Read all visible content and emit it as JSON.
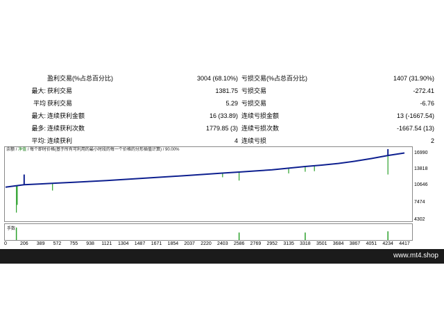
{
  "stats": [
    {
      "prefix": "",
      "label": "盈利交易(%占总百分比)",
      "value": "3004 (68.10%)",
      "label2": "亏损交易(%占总百分比)",
      "value2": "1407 (31.90%)"
    },
    {
      "prefix": "最大:",
      "label": "获利交易",
      "value": "1381.75",
      "label2": "亏损交易",
      "value2": "-272.41"
    },
    {
      "prefix": "平均",
      "label": "获利交易",
      "value": "5.29",
      "label2": "亏损交易",
      "value2": "-6.76"
    },
    {
      "prefix": "最大:",
      "label": "连续获利金额",
      "value": "16 (33.89)",
      "label2": "连续亏损金额",
      "value2": "13 (-1667.54)"
    },
    {
      "prefix": "最多:",
      "label": "连续获利次数",
      "value": "1779.85 (3)",
      "label2": "连续亏损次数",
      "value2": "-1667.54 (13)"
    },
    {
      "prefix": "平均:",
      "label": "连续获利",
      "value": "4",
      "label2": "连续亏损",
      "value2": "2"
    }
  ],
  "chart": {
    "title_balance": "余额",
    "title_equity": "净值",
    "title_rest": "/ 每个即时价格(基于所有可利用的最小时段的每一个价格的分形插值计算) / 90.00%",
    "volume_label": "手数",
    "colors": {
      "balance": "#0d1f8f",
      "equity": "#2aa02a",
      "border": "#888888"
    }
  },
  "chart_data": {
    "type": "line",
    "x_ticks": [
      "0",
      "206",
      "389",
      "572",
      "755",
      "938",
      "1121",
      "1304",
      "1487",
      "1671",
      "1854",
      "2037",
      "2220",
      "2403",
      "2586",
      "2769",
      "2952",
      "3135",
      "3318",
      "3501",
      "3684",
      "3867",
      "4051",
      "4234",
      "4417"
    ],
    "y_ticks": [
      "16990",
      "13818",
      "10646",
      "7474",
      "4302"
    ],
    "ylim": [
      4302,
      16990
    ],
    "xlim": [
      0,
      4417
    ],
    "series": [
      {
        "name": "余额",
        "values": [
          [
            0,
            10100
          ],
          [
            206,
            10550
          ],
          [
            389,
            10700
          ],
          [
            572,
            10850
          ],
          [
            755,
            11000
          ],
          [
            938,
            11150
          ],
          [
            1121,
            11300
          ],
          [
            1304,
            11500
          ],
          [
            1487,
            11680
          ],
          [
            1671,
            11860
          ],
          [
            1854,
            12050
          ],
          [
            2037,
            12250
          ],
          [
            2220,
            12450
          ],
          [
            2403,
            12650
          ],
          [
            2586,
            12850
          ],
          [
            2769,
            13050
          ],
          [
            2952,
            13250
          ],
          [
            3135,
            13550
          ],
          [
            3318,
            13850
          ],
          [
            3501,
            14100
          ],
          [
            3684,
            14400
          ],
          [
            3867,
            14800
          ],
          [
            4051,
            15300
          ],
          [
            4234,
            15850
          ],
          [
            4417,
            16300
          ]
        ]
      }
    ],
    "equity_dips": [
      [
        120,
        5500
      ],
      [
        130,
        6900
      ],
      [
        520,
        9500
      ],
      [
        2403,
        11900
      ],
      [
        2586,
        11300
      ],
      [
        3135,
        12600
      ],
      [
        3318,
        12900
      ],
      [
        3420,
        13000
      ],
      [
        4234,
        12400
      ]
    ],
    "volume_spikes": [
      [
        120,
        1
      ],
      [
        2586,
        0.6
      ],
      [
        3318,
        0.6
      ],
      [
        4234,
        0.7
      ]
    ]
  }
}
